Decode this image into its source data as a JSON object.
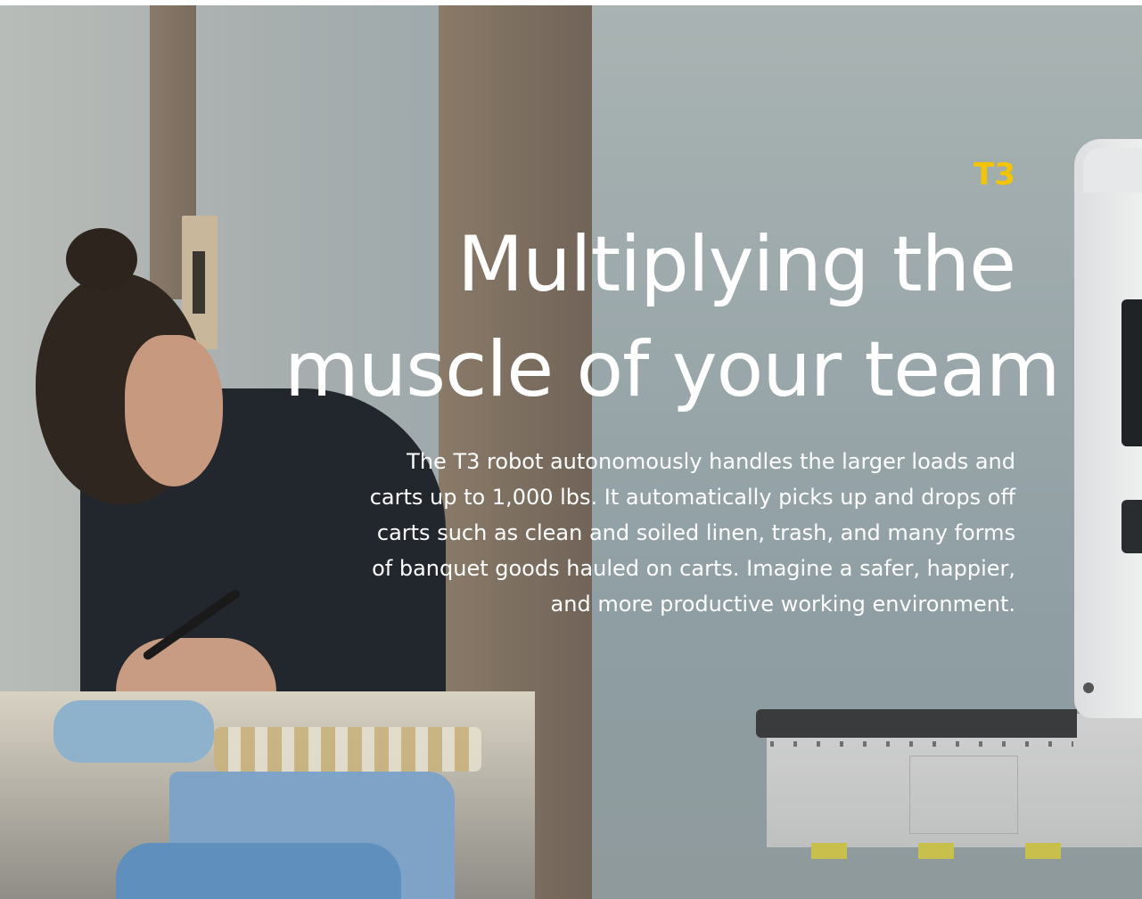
{
  "hero": {
    "eyebrow": "T3",
    "headline_lines": [
      "Multiplying the",
      "muscle of your team"
    ],
    "description_lines": [
      "The T3 robot autonomously handles the larger loads and",
      "carts up to 1,000 lbs. It automatically picks up and drops off",
      "carts such as clean and soiled linen, trash, and many forms",
      "of banquet goods hauled on carts. Imagine a safer, happier,",
      "and more productive working environment."
    ]
  },
  "colors": {
    "accent": "#f3c500",
    "text": "#ffffff"
  }
}
